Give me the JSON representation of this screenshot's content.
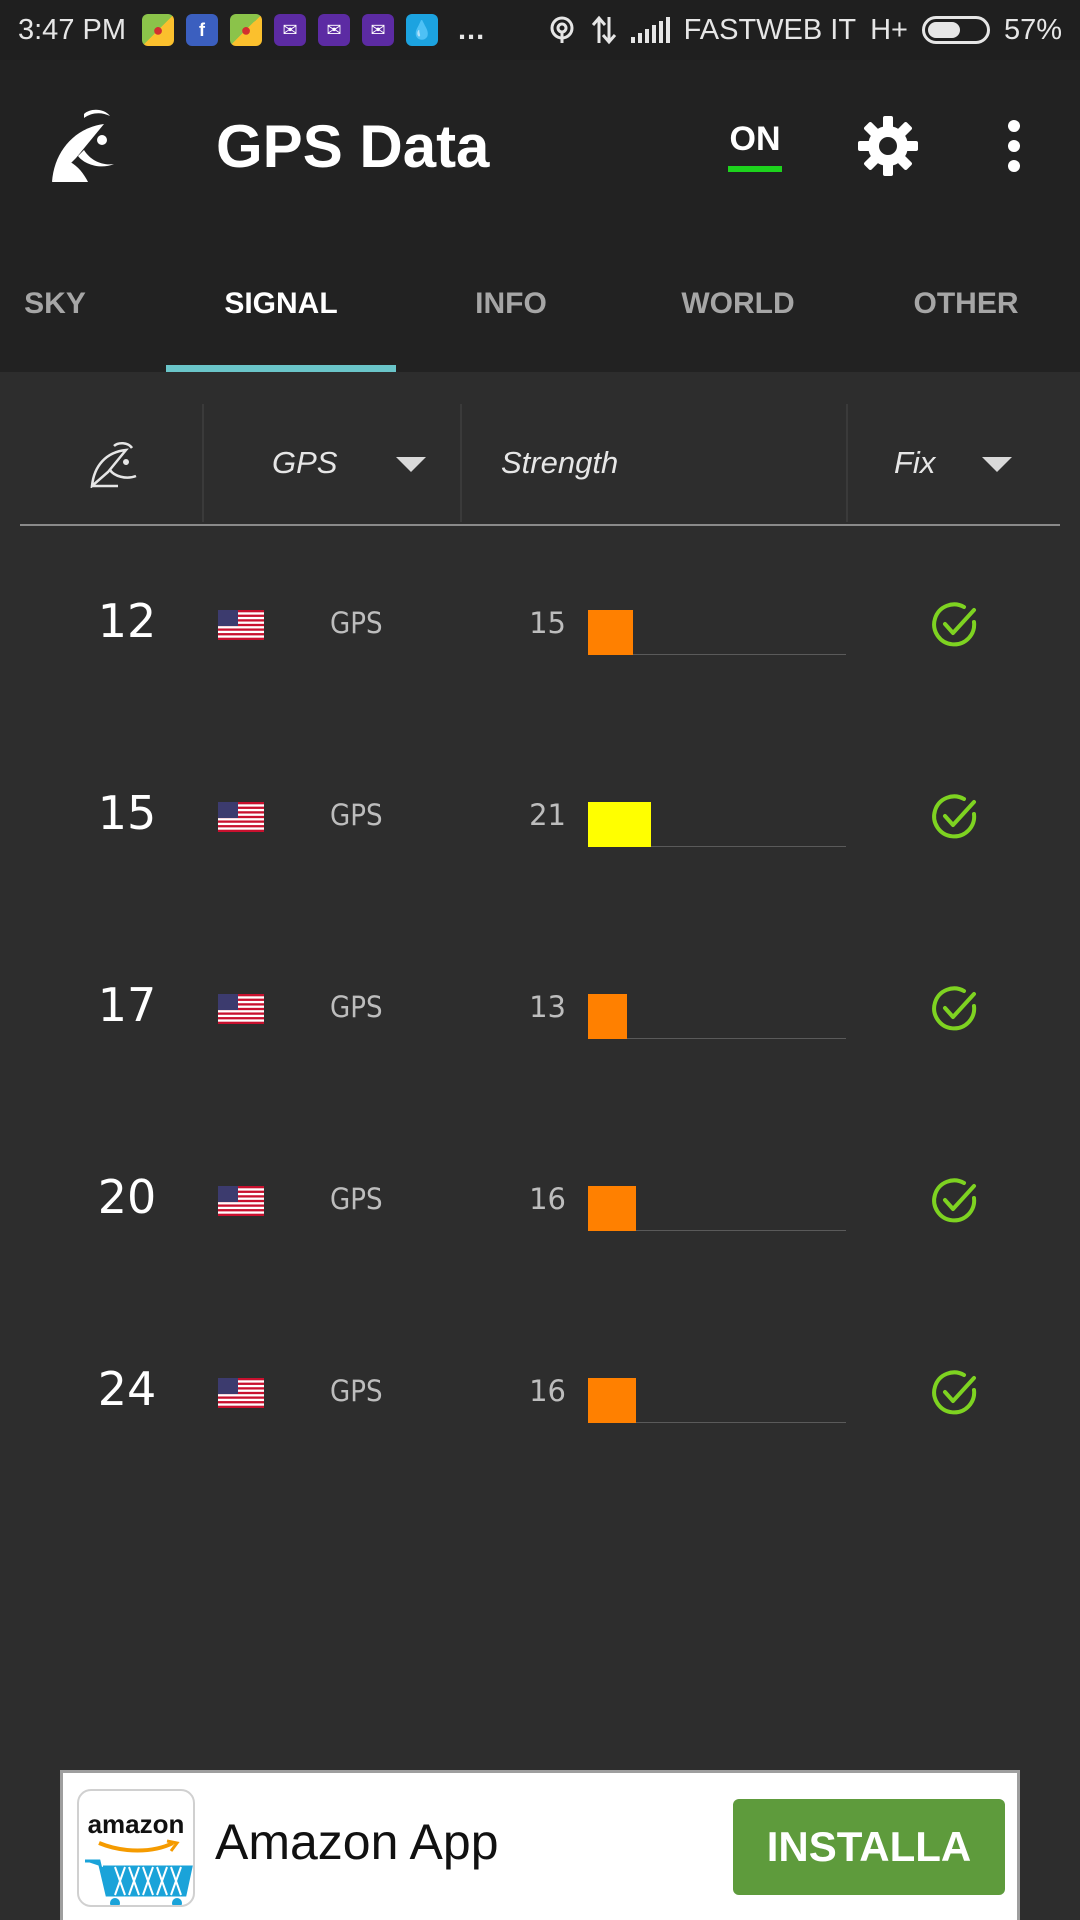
{
  "status_bar": {
    "time": "3:47 PM",
    "carrier": "FASTWEB IT",
    "network": "H+",
    "battery": "57%",
    "overflow": "...",
    "notification_icons": [
      "maps-icon",
      "facebook-icon",
      "maps-icon",
      "yahoo-mail-icon",
      "yahoo-mail-icon",
      "yahoo-mail-icon",
      "water-drop-icon"
    ]
  },
  "app_bar": {
    "title": "GPS Data",
    "toggle_label": "ON"
  },
  "tabs": [
    {
      "label": "SKY",
      "active": false
    },
    {
      "label": "SIGNAL",
      "active": true
    },
    {
      "label": "INFO",
      "active": false
    },
    {
      "label": "WORLD",
      "active": false
    },
    {
      "label": "OTHER",
      "active": false
    }
  ],
  "table": {
    "headers": {
      "system": "GPS",
      "strength": "Strength",
      "fix": "Fix"
    },
    "rows": [
      {
        "prn": "12",
        "system": "GPS",
        "snr": "15",
        "strength": 15,
        "color": "#ff8000",
        "fix": true
      },
      {
        "prn": "15",
        "system": "GPS",
        "snr": "21",
        "strength": 21,
        "color": "#ffff00",
        "fix": true
      },
      {
        "prn": "17",
        "system": "GPS",
        "snr": "13",
        "strength": 13,
        "color": "#ff8000",
        "fix": true
      },
      {
        "prn": "20",
        "system": "GPS",
        "snr": "16",
        "strength": 16,
        "color": "#ff8000",
        "fix": true
      },
      {
        "prn": "24",
        "system": "GPS",
        "snr": "16",
        "strength": 16,
        "color": "#ff8000",
        "fix": true
      }
    ]
  },
  "ad": {
    "logo_text": "amazon",
    "title": "Amazon App",
    "button_label": "INSTALLA"
  },
  "colors": {
    "accent_tab": "#6ac5c9",
    "toggle_on": "#1dd31d",
    "fix_check": "#7ed321",
    "ad_button": "#5e9b3c"
  }
}
